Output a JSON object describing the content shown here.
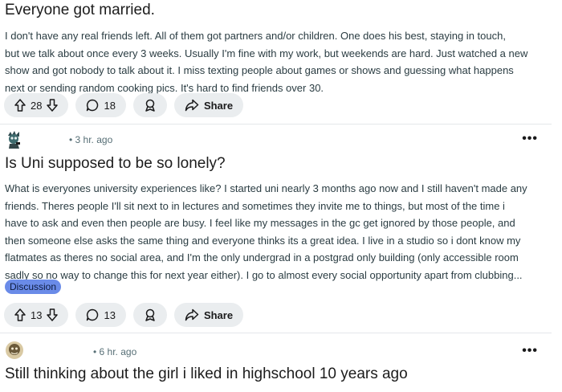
{
  "posts": [
    {
      "title": "Everyone got married.",
      "body_lines": [
        "I don't have any real friends left. All of them got partners and/or children. One does his best, staying in touch,",
        "but we talk about once every 3 weeks. Usually I'm fine with my work, but weekends are hard. Just watched a new",
        "show and got nobody to talk about it. I miss texting people about games or shows and guessing what happens",
        "next or sending random cooking pics. It's hard to find friends over 30."
      ],
      "votes": "28",
      "comments": "18",
      "share_label": "Share"
    },
    {
      "time": "• 3 hr. ago",
      "title": "Is Uni supposed to be so lonely?",
      "body_lines": [
        "What is everyones university experiences like? I started uni nearly 3 months ago now and I still haven't made any",
        "friends. Theres people I'll sit next to in lectures and sometimes they invite me to things, but most of the time i",
        "have to ask and even then people are busy. I feel like my messages in the gc get ignored by those people, and",
        "then someone else asks the same thing and everyone thinks its a great idea. I live in a studio so i dont know my",
        "flatmates as theres no social area, and I'm the only undergrad in a postgrad only building (only accessible room",
        "sadly so no way to change this for next year either). I go to almost every social opportunity apart from clubbing..."
      ],
      "flair": "Discussion",
      "votes": "13",
      "comments": "13",
      "share_label": "Share",
      "more": "•••"
    },
    {
      "time": "• 6 hr. ago",
      "title": "Still thinking about the girl i liked in highschool 10 years ago",
      "more": "•••"
    }
  ],
  "icons": {
    "upvote": "upvote-icon",
    "downvote": "downvote-icon",
    "comment": "comment-icon",
    "award": "award-icon",
    "share": "share-icon"
  },
  "colors": {
    "pill_bg": "#eaedef",
    "flair_bg": "#6a8be8",
    "meta_text": "#576f76"
  }
}
